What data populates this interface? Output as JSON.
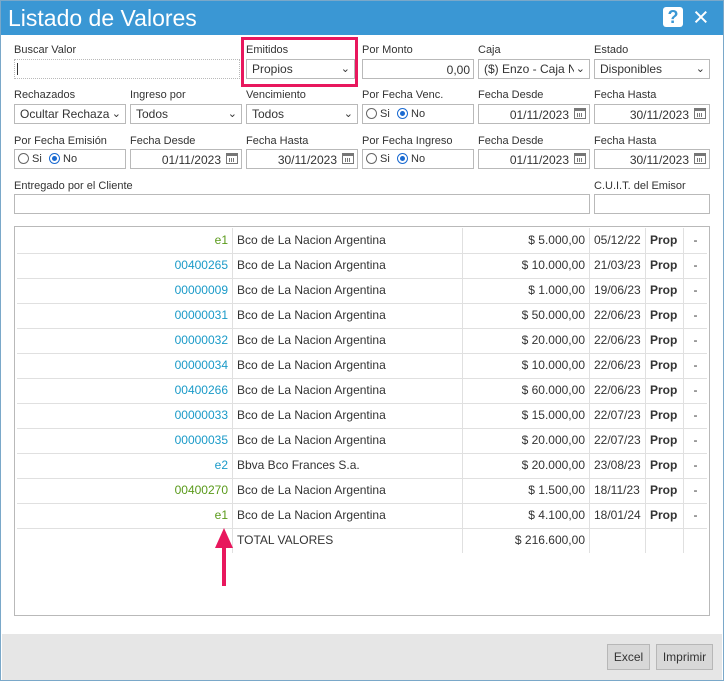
{
  "title": "Listado de Valores",
  "help_icon": "?",
  "close_icon": "×",
  "filters": {
    "buscar_label": "Buscar Valor",
    "buscar_value": "",
    "emitidos_label": "Emitidos",
    "emitidos_value": "Propios",
    "monto_label": "Por Monto",
    "monto_value": "0,00",
    "caja_label": "Caja",
    "caja_value": "($) Enzo - Caja N",
    "estado_label": "Estado",
    "estado_value": "Disponibles",
    "rechazados_label": "Rechazados",
    "rechazados_value": "Ocultar Rechaza",
    "ingreso_label": "Ingreso por",
    "ingreso_value": "Todos",
    "vencimiento_label": "Vencimiento",
    "vencimiento_value": "Todos",
    "fecha_venc_label": "Por Fecha Venc.",
    "fecha_emision_label": "Por Fecha Emisión",
    "fecha_ingreso_label": "Por Fecha Ingreso",
    "si": "Si",
    "no": "No",
    "fecha_desde_label": "Fecha Desde",
    "fecha_hasta_label": "Fecha Hasta",
    "fecha_desde_value": "01/11/2023",
    "fecha_hasta_value": "30/11/2023",
    "entregado_label": "Entregado por el Cliente",
    "cuit_label": "C.U.I.T. del Emisor"
  },
  "table": {
    "rows": [
      {
        "numero": "e1",
        "banco": "Bco de La Nacion Argentina",
        "importe": "$ 5.000,00",
        "fecha": "05/12/22",
        "tipo": "Prop",
        "extra": "-",
        "color": "#5a9a1b"
      },
      {
        "numero": "00400265",
        "banco": "Bco de La Nacion Argentina",
        "importe": "$ 10.000,00",
        "fecha": "21/03/23",
        "tipo": "Prop",
        "extra": "-",
        "color": "#1a9ac8"
      },
      {
        "numero": "00000009",
        "banco": "Bco de La Nacion Argentina",
        "importe": "$ 1.000,00",
        "fecha": "19/06/23",
        "tipo": "Prop",
        "extra": "-",
        "color": "#1a9ac8"
      },
      {
        "numero": "00000031",
        "banco": "Bco de La Nacion Argentina",
        "importe": "$ 50.000,00",
        "fecha": "22/06/23",
        "tipo": "Prop",
        "extra": "-",
        "color": "#1a9ac8"
      },
      {
        "numero": "00000032",
        "banco": "Bco de La Nacion Argentina",
        "importe": "$ 20.000,00",
        "fecha": "22/06/23",
        "tipo": "Prop",
        "extra": "-",
        "color": "#1a9ac8"
      },
      {
        "numero": "00000034",
        "banco": "Bco de La Nacion Argentina",
        "importe": "$ 10.000,00",
        "fecha": "22/06/23",
        "tipo": "Prop",
        "extra": "-",
        "color": "#1a9ac8"
      },
      {
        "numero": "00400266",
        "banco": "Bco de La Nacion Argentina",
        "importe": "$ 60.000,00",
        "fecha": "22/06/23",
        "tipo": "Prop",
        "extra": "-",
        "color": "#1a9ac8"
      },
      {
        "numero": "00000033",
        "banco": "Bco de La Nacion Argentina",
        "importe": "$ 15.000,00",
        "fecha": "22/07/23",
        "tipo": "Prop",
        "extra": "-",
        "color": "#1a9ac8"
      },
      {
        "numero": "00000035",
        "banco": "Bco de La Nacion Argentina",
        "importe": "$ 20.000,00",
        "fecha": "22/07/23",
        "tipo": "Prop",
        "extra": "-",
        "color": "#1a9ac8"
      },
      {
        "numero": "e2",
        "banco": "Bbva Bco Frances S.a.",
        "importe": "$ 20.000,00",
        "fecha": "23/08/23",
        "tipo": "Prop",
        "extra": "-",
        "color": "#1a9ac8"
      },
      {
        "numero": "00400270",
        "banco": "Bco de La Nacion Argentina",
        "importe": "$ 1.500,00",
        "fecha": "18/11/23",
        "tipo": "Prop",
        "extra": "-",
        "color": "#5a9a1b"
      },
      {
        "numero": "e1",
        "banco": "Bco de La Nacion Argentina",
        "importe": "$ 4.100,00",
        "fecha": "18/01/24",
        "tipo": "Prop",
        "extra": "-",
        "color": "#5a9a1b"
      }
    ],
    "total_label": "TOTAL VALORES",
    "total_value": "$ 216.600,00"
  },
  "buttons": {
    "excel": "Excel",
    "imprimir": "Imprimir"
  },
  "colors": {
    "titlebar": "#3a97d4",
    "highlight": "#e8175d"
  }
}
